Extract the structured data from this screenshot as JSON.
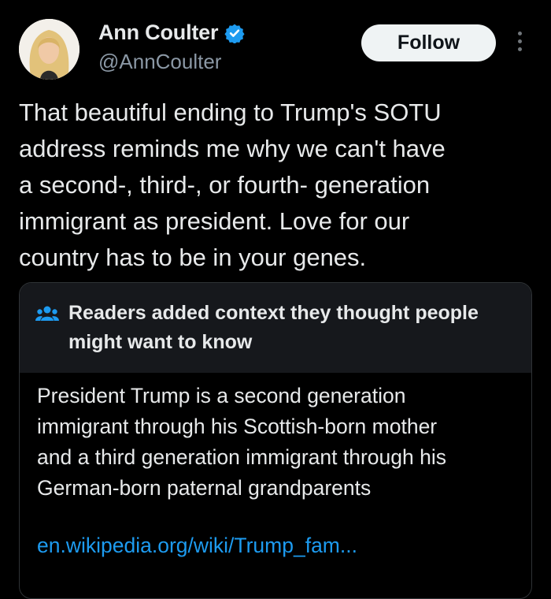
{
  "user": {
    "display_name": "Ann Coulter",
    "handle": "@AnnCoulter",
    "verified_icon": "verified-badge-icon",
    "verified_color": "#1d9bf0"
  },
  "actions": {
    "follow_label": "Follow",
    "more_icon": "more-vertical-icon"
  },
  "tweet": {
    "text": "That beautiful ending to Trump's SOTU\naddress reminds me why we can't have\na second-, third-, or fourth- generation\nimmigrant as president.  Love for our\ncountry has to be in your genes."
  },
  "community_note": {
    "icon": "people-icon",
    "title": "Readers added context they thought people might want to know",
    "body": "President Trump is a second generation\nimmigrant through his Scottish-born mother\nand a third generation immigrant through his\nGerman-born paternal grandparents",
    "link": "en.wikipedia.org/wiki/Trump_fam..."
  },
  "colors": {
    "background": "#000000",
    "text_primary": "#e7e9ea",
    "text_secondary": "#8b98a5",
    "accent": "#1d9bf0",
    "note_header_bg": "#16181c"
  }
}
